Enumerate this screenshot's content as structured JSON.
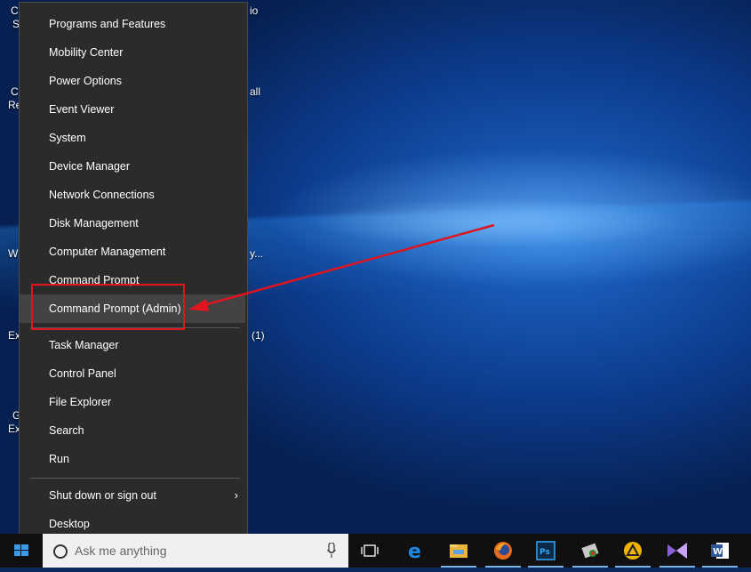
{
  "desktop": {
    "fragments": [
      "C",
      "S",
      "io",
      "C",
      "Re",
      "all",
      "W",
      "y...",
      "Ex",
      "(1)",
      "G",
      "Ex"
    ]
  },
  "menu": {
    "items": [
      "Programs and Features",
      "Mobility Center",
      "Power Options",
      "Event Viewer",
      "System",
      "Device Manager",
      "Network Connections",
      "Disk Management",
      "Computer Management",
      "Command Prompt",
      "Command Prompt (Admin)",
      "Task Manager",
      "Control Panel",
      "File Explorer",
      "Search",
      "Run",
      "Shut down or sign out",
      "Desktop"
    ],
    "submenu_chevron": "›"
  },
  "annotation": {
    "color": "#e0141e"
  },
  "taskbar": {
    "search_placeholder": "Ask me anything",
    "icons": [
      "task-view-icon",
      "edge-icon",
      "file-explorer-icon",
      "firefox-icon",
      "photoshop-icon",
      "app-icon",
      "app-triangle-icon",
      "visual-studio-icon",
      "word-icon"
    ]
  }
}
